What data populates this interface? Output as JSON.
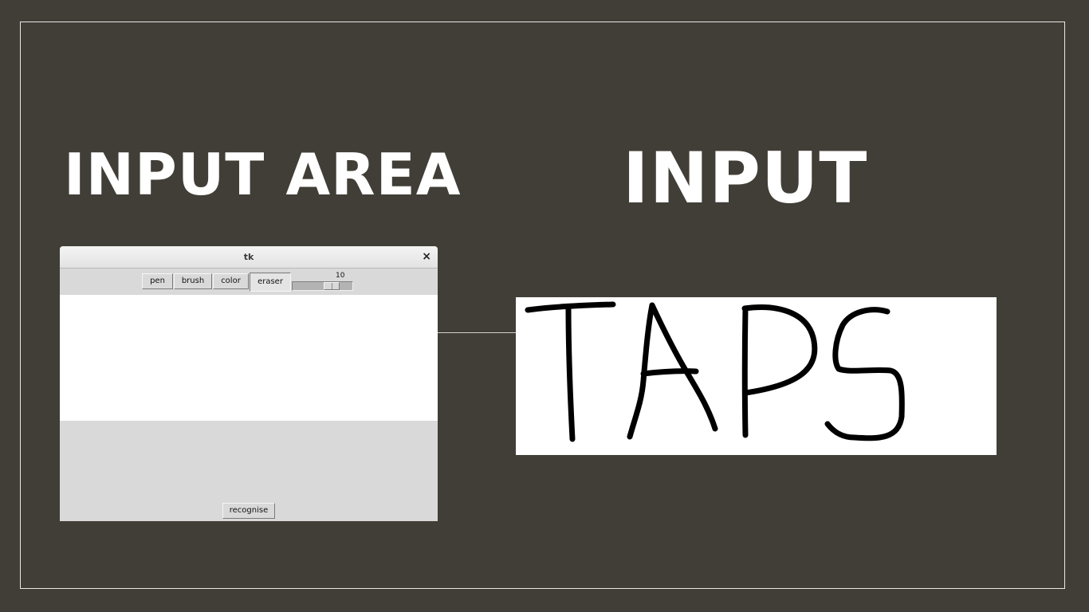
{
  "headings": {
    "left": "INPUT AREA",
    "right": "INPUT"
  },
  "tk_window": {
    "title": "tk",
    "close_glyph": "×",
    "toolbar": {
      "pen_label": "pen",
      "brush_label": "brush",
      "color_label": "color",
      "eraser_label": "eraser",
      "size_value": "10",
      "size_fraction": 0.7
    },
    "recognise_label": "recognise"
  },
  "input_image": {
    "handwritten_text": "TAPS"
  },
  "colors": {
    "background": "#413e37",
    "frame_border": "#e8e8e8",
    "heading_text": "#ffffff",
    "tk_bg": "#d9d9d9",
    "canvas": "#ffffff",
    "ink": "#000000"
  }
}
